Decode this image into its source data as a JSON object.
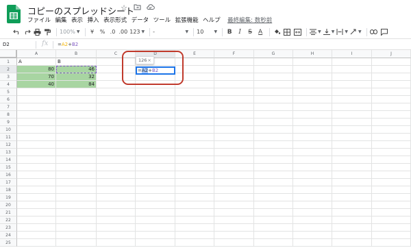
{
  "app": {
    "doc_title": "コピーのスプレッドシート",
    "menu": [
      "ファイル",
      "編集",
      "表示",
      "挿入",
      "表示形式",
      "データ",
      "ツール",
      "拡張機能",
      "ヘルプ"
    ],
    "last_edit": "最終編集: 数秒前"
  },
  "toolbar": {
    "zoom": "100%",
    "currency": "¥",
    "percent": "%",
    "dec_dec": ".0",
    "dec_inc": ".00",
    "format_more": "123",
    "font": "-",
    "font_size": "10"
  },
  "formula_bar": {
    "cell_ref": "D2",
    "fx": "fx",
    "eq": "=",
    "ref1": "A2",
    "op": "+",
    "ref2": "B2"
  },
  "columns": [
    "A",
    "B",
    "C",
    "D",
    "E",
    "F",
    "G",
    "H",
    "I",
    "J"
  ],
  "rows": [
    "1",
    "2",
    "3",
    "4",
    "5",
    "6",
    "7",
    "8",
    "9",
    "10",
    "11",
    "12",
    "13",
    "14",
    "15",
    "16",
    "17",
    "18",
    "19",
    "20",
    "21",
    "22",
    "23",
    "24",
    "25"
  ],
  "cells": {
    "a1": "A",
    "b1": "B",
    "a2": "80",
    "b2": "46",
    "a3": "70",
    "b3": "32",
    "a4": "40",
    "b4": "84"
  },
  "editor": {
    "preview": "126",
    "close": "×",
    "eq": "=",
    "ref1": "A2",
    "op": "+",
    "ref2": "B2"
  },
  "colors": {
    "green_fill": "#a8d5a2",
    "selection": "#1a73e8",
    "ref_a": "#f4b400",
    "ref_b": "#7e57c2",
    "annotation": "#c0392b"
  }
}
